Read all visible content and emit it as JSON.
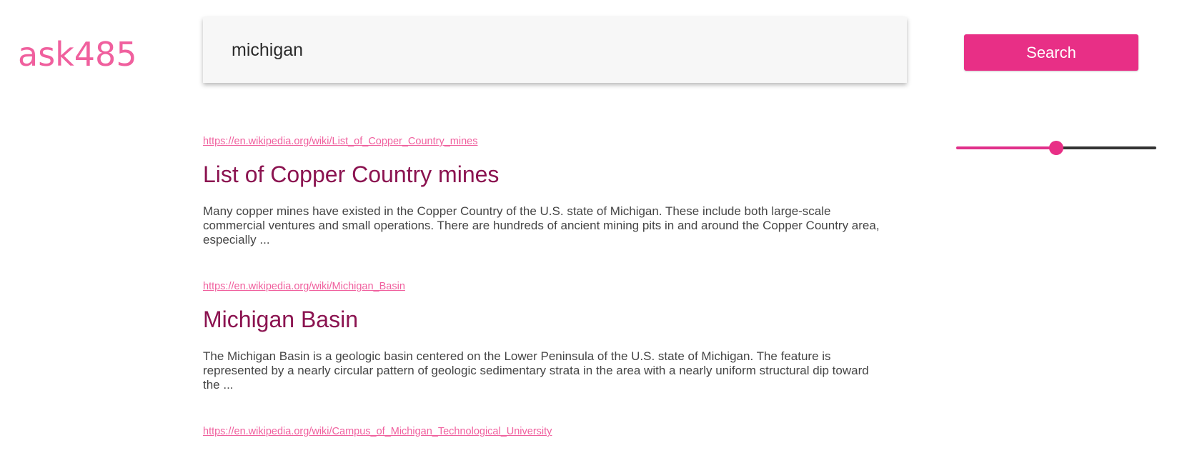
{
  "brand": {
    "logo_text": "ask485",
    "accent_color": "#e82f86",
    "logo_color": "#f0609e",
    "title_color": "#8b1350"
  },
  "search": {
    "query": "michigan",
    "button_label": "Search"
  },
  "slider": {
    "value_fraction": 0.5
  },
  "results": [
    {
      "url": "https://en.wikipedia.org/wiki/List_of_Copper_Country_mines",
      "title": "List of Copper Country mines",
      "snippet": "Many copper mines have existed in the Copper Country of the U.S. state of Michigan. These include both large-scale commercial ventures and small operations. There are hundreds of ancient mining pits in and around the Copper Country area, especially ..."
    },
    {
      "url": "https://en.wikipedia.org/wiki/Michigan_Basin",
      "title": "Michigan Basin",
      "snippet": "The Michigan Basin is a geologic basin centered on the Lower Peninsula of the U.S. state of Michigan. The feature is represented by a nearly circular pattern of geologic sedimentary strata in the area with a nearly uniform structural dip toward the ..."
    },
    {
      "url": "https://en.wikipedia.org/wiki/Campus_of_Michigan_Technological_University",
      "title": "",
      "snippet": ""
    }
  ]
}
